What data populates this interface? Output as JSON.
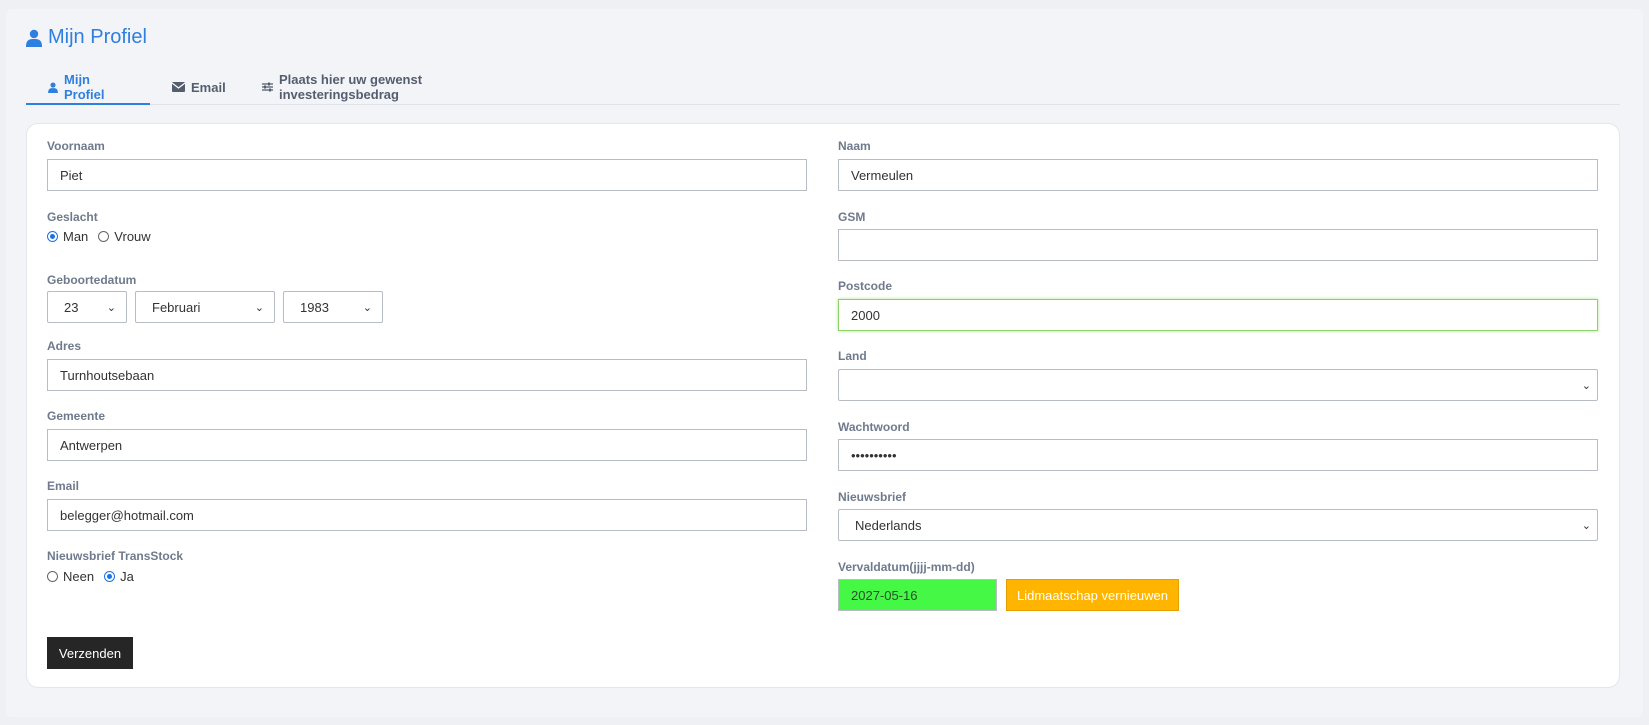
{
  "header": {
    "title": "Mijn Profiel"
  },
  "tabs": [
    {
      "label": "Mijn Profiel",
      "icon": "user-icon"
    },
    {
      "label": "Email",
      "icon": "envelope-icon"
    },
    {
      "label": "Plaats hier uw gewenst investeringsbedrag",
      "icon": "sliders-icon"
    }
  ],
  "form": {
    "voornaam": {
      "label": "Voornaam",
      "value": "Piet"
    },
    "naam": {
      "label": "Naam",
      "value": "Vermeulen"
    },
    "geslacht": {
      "label": "Geslacht",
      "options": [
        "Man",
        "Vrouw"
      ],
      "selected": "Man"
    },
    "gsm": {
      "label": "GSM",
      "value": ""
    },
    "geboortedatum": {
      "label": "Geboortedatum",
      "day": "23",
      "month": "Februari",
      "year": "1983"
    },
    "postcode": {
      "label": "Postcode",
      "value": "2000"
    },
    "adres": {
      "label": "Adres",
      "value": "Turnhoutsebaan"
    },
    "land": {
      "label": "Land",
      "value": ""
    },
    "gemeente": {
      "label": "Gemeente",
      "value": "Antwerpen"
    },
    "wachtwoord": {
      "label": "Wachtwoord",
      "value": "••••••••••"
    },
    "email": {
      "label": "Email",
      "value": "belegger@hotmail.com"
    },
    "nieuwsbrief": {
      "label": "Nieuwsbrief",
      "value": "Nederlands"
    },
    "nieuwsbrief_transstock": {
      "label": "Nieuwsbrief TransStock",
      "options": [
        "Neen",
        "Ja"
      ],
      "selected": "Ja"
    },
    "vervaldatum": {
      "label": "Vervaldatum(jjjj-mm-dd)",
      "value": "2027-05-16"
    },
    "renew_label": "Lidmaatschap vernieuwen",
    "submit_label": "Verzenden"
  },
  "colors": {
    "accent": "#2f7fe0",
    "expiry_bg": "#45f845",
    "renew_bg": "#ffb400",
    "submit_bg": "#262626"
  }
}
